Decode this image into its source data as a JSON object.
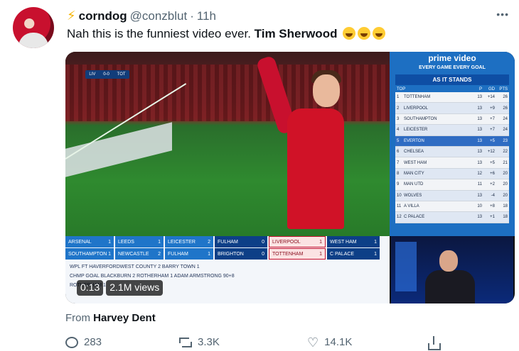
{
  "tweet": {
    "display_name": "corndog",
    "handle": "@conzblut",
    "separator": "·",
    "time": "11h",
    "text_prefix": "Nah this is the funniest video ever. ",
    "text_bold": "Tim Sherwood",
    "more": "•••"
  },
  "video": {
    "duration": "0:13",
    "views": "2.1M views",
    "scorebug": {
      "home": "LIV",
      "score": "0-0",
      "away": "TOT"
    },
    "panel": {
      "brand": "prime video",
      "tagline": "EVERY GAME EVERY GOAL",
      "header": "AS IT STANDS",
      "columns": [
        "TOP",
        "P",
        "GD",
        "PTS"
      ],
      "rows": [
        {
          "pos": "1",
          "team": "TOTTENHAM",
          "p": "13",
          "gd": "+14",
          "pts": "26"
        },
        {
          "pos": "2",
          "team": "LIVERPOOL",
          "p": "13",
          "gd": "+9",
          "pts": "26"
        },
        {
          "pos": "3",
          "team": "SOUTHAMPTON",
          "p": "13",
          "gd": "+7",
          "pts": "24"
        },
        {
          "pos": "4",
          "team": "LEICESTER",
          "p": "13",
          "gd": "+7",
          "pts": "24"
        },
        {
          "pos": "5",
          "team": "EVERTON",
          "p": "13",
          "gd": "+5",
          "pts": "23"
        },
        {
          "pos": "6",
          "team": "CHELSEA",
          "p": "13",
          "gd": "+12",
          "pts": "22"
        },
        {
          "pos": "7",
          "team": "WEST HAM",
          "p": "13",
          "gd": "+5",
          "pts": "21"
        },
        {
          "pos": "8",
          "team": "MAN CITY",
          "p": "12",
          "gd": "+6",
          "pts": "20"
        },
        {
          "pos": "9",
          "team": "MAN UTD",
          "p": "11",
          "gd": "+2",
          "pts": "20"
        },
        {
          "pos": "10",
          "team": "WOLVES",
          "p": "13",
          "gd": "-4",
          "pts": "20"
        },
        {
          "pos": "11",
          "team": "A VILLA",
          "p": "10",
          "gd": "+8",
          "pts": "18"
        },
        {
          "pos": "12",
          "team": "C PALACE",
          "p": "13",
          "gd": "+1",
          "pts": "18"
        }
      ]
    },
    "ticker": {
      "row1": [
        {
          "a": "ARSENAL",
          "b": "1"
        },
        {
          "a": "LEEDS",
          "b": "1"
        },
        {
          "a": "LEICESTER",
          "b": "2"
        }
      ],
      "row2": [
        {
          "a": "SOUTHAMPTON",
          "b": "1"
        },
        {
          "a": "NEWCASTLE",
          "b": "2"
        },
        {
          "a": "FULHAM",
          "b": "1"
        }
      ],
      "row1_right": [
        {
          "a": "FULHAM",
          "b": "0"
        },
        {
          "a": "LIVERPOOL",
          "b": "1"
        },
        {
          "a": "WEST HAM",
          "b": "1"
        }
      ],
      "row2_right": [
        {
          "a": "BRIGHTON",
          "b": "0"
        },
        {
          "a": "TOTTENHAM",
          "b": "1"
        },
        {
          "a": "C PALACE",
          "b": "1"
        }
      ],
      "lines": [
        "WPL    FT    HAVERFORDWEST COUNTY 2   BARRY TOWN 1",
        "CHMP   GOAL   BLACKBURN 2  ROTHERHAM 1       ADAM ARMSTRONG 90+8",
        "                      ROTHERHAM 1"
      ]
    }
  },
  "attribution": {
    "label": "From ",
    "source": "Harvey Dent"
  },
  "actions": {
    "replies": "283",
    "retweets": "3.3K",
    "likes": "14.1K"
  }
}
